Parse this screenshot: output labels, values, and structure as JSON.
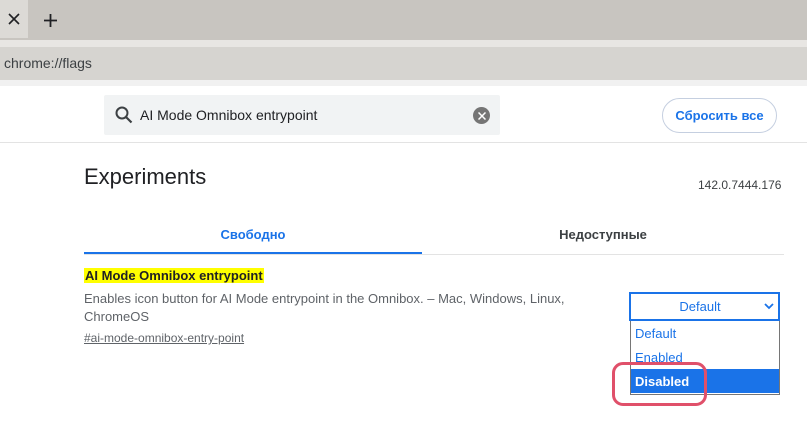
{
  "browser": {
    "address": "chrome://flags",
    "close_tab_icon": "close-icon",
    "new_tab_icon": "plus-icon"
  },
  "search": {
    "value": "AI Mode Omnibox entrypoint",
    "search_icon": "search-icon",
    "clear_icon": "clear-icon"
  },
  "header": {
    "reset_label": "Сбросить все"
  },
  "main": {
    "title": "Experiments",
    "version": "142.0.7444.176",
    "tabs": [
      {
        "label": "Свободно",
        "active": true
      },
      {
        "label": "Недоступные",
        "active": false
      }
    ]
  },
  "experiment": {
    "title": "AI Mode Omnibox entrypoint",
    "description": "Enables icon button for AI Mode entrypoint in the Omnibox. – Mac, Windows, Linux, ChromeOS",
    "link": "#ai-mode-omnibox-entry-point",
    "select_value": "Default",
    "options": [
      "Default",
      "Enabled",
      "Disabled"
    ],
    "highlighted_option": "Disabled"
  },
  "colors": {
    "accent": "#1a73e8",
    "highlight": "#ffff00",
    "annotation_ring": "#e0506a"
  }
}
